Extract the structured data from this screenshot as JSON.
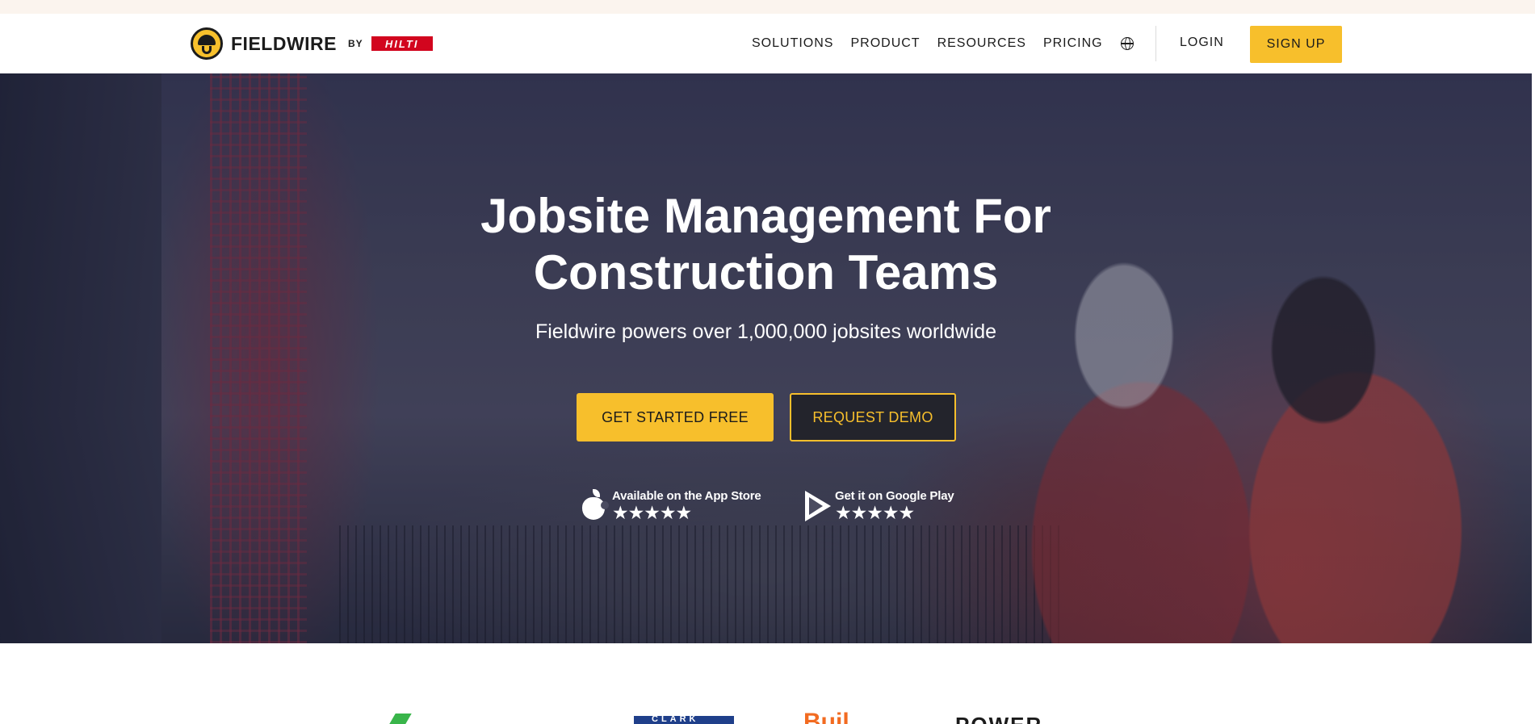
{
  "nav": {
    "brand_name": "FIELDWIRE",
    "brand_by": "BY",
    "partner_logo_text": "HILTI",
    "links": [
      "SOLUTIONS",
      "PRODUCT",
      "RESOURCES",
      "PRICING"
    ],
    "language_icon": "globe-icon",
    "login_label": "LOGIN",
    "signup_label": "SIGN UP"
  },
  "hero": {
    "title_line1": "Jobsite Management For",
    "title_line2": "Construction Teams",
    "subtitle": "Fieldwire powers over 1,000,000 jobsites worldwide",
    "primary_cta": "GET STARTED FREE",
    "secondary_cta": "REQUEST DEMO",
    "app_store": {
      "label": "Available on the App Store",
      "icon": "apple-icon",
      "stars": 5
    },
    "google_play": {
      "label": "Get it on Google Play",
      "icon": "google-play-icon",
      "stars": 5
    }
  },
  "customer_logos": {
    "partial_logo_2_text": "CLARK",
    "partial_logo_3_text": "Buil",
    "partial_logo_4_text": "POWER"
  },
  "colors": {
    "accent_yellow": "#f7bf2c",
    "brand_red": "#d2051e",
    "text_dark": "#1b1b1b"
  }
}
